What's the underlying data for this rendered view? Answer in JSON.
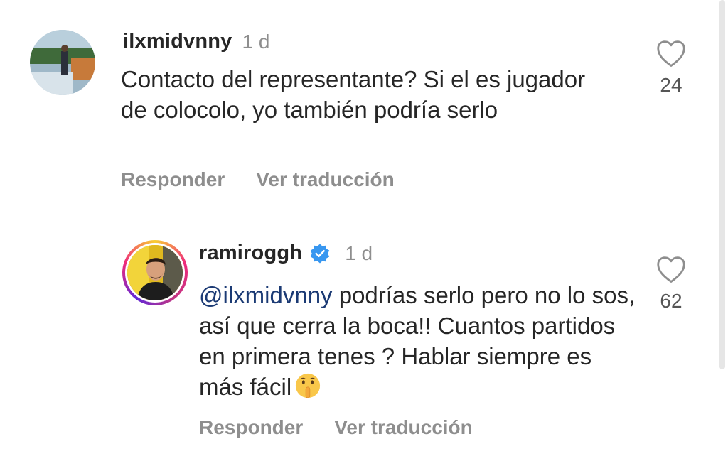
{
  "comments": [
    {
      "username": "ilxmidvnny",
      "time": "1 d",
      "text": "Contacto del representante? Si el es jugador de colocolo, yo también podría serlo",
      "reply_label": "Responder",
      "translate_label": "Ver traducción",
      "likes": "24"
    },
    {
      "username": "ramiroggh",
      "verified": true,
      "time": "1 d",
      "mention": "@ilxmidvnny",
      "text": " podrías serlo pero no lo sos, así que cerra la boca!! Cuantos partidos en primera tenes ? Hablar siempre es más fácil",
      "emoji": "shushing-face-emoji",
      "reply_label": "Responder",
      "translate_label": "Ver traducción",
      "likes": "62"
    }
  ],
  "colors": {
    "text": "#262626",
    "muted": "#8e8e8e",
    "mention": "#1b3a74",
    "verified": "#3897f0"
  }
}
